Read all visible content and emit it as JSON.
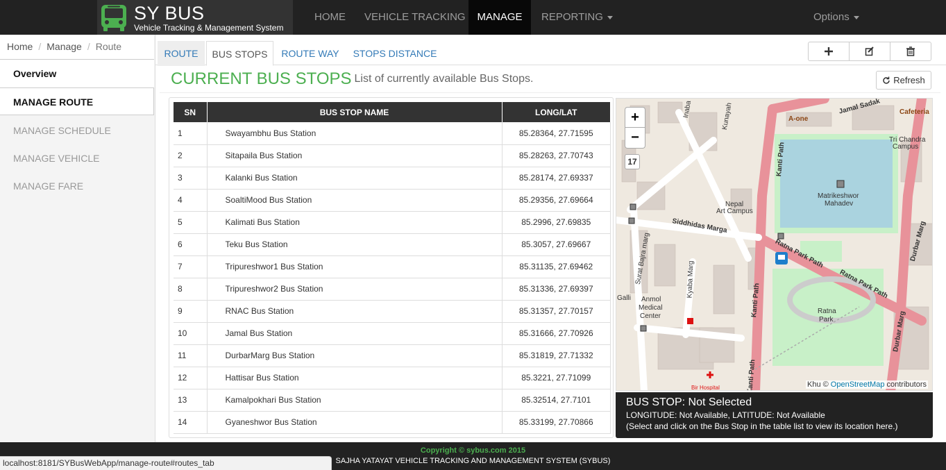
{
  "brand": {
    "title": "SY BUS",
    "subtitle": "Vehicle Tracking & Management System"
  },
  "nav": {
    "home": "HOME",
    "tracking": "VEHICLE TRACKING",
    "manage": "MANAGE",
    "reporting": "REPORTING",
    "options": "Options"
  },
  "breadcrumb": {
    "home": "Home",
    "manage": "Manage",
    "route": "Route",
    "sep": "/"
  },
  "sidebar": {
    "overview": "Overview",
    "manage_route": "MANAGE ROUTE",
    "manage_schedule": "MANAGE SCHEDULE",
    "manage_vehicle": "MANAGE VEHICLE",
    "manage_fare": "MANAGE FARE"
  },
  "tabs": {
    "route": "ROUTE",
    "bus_stops": "BUS STOPS",
    "route_way": "ROUTE WAY",
    "stops_distance": "STOPS DISTANCE"
  },
  "actions": {
    "add_icon": "plus-icon",
    "edit_icon": "edit-icon",
    "delete_icon": "trash-icon"
  },
  "heading": {
    "title": "CURRENT BUS STOPS",
    "subtitle": "List of currently available Bus Stops."
  },
  "refresh": {
    "label": "Refresh",
    "icon": "refresh-icon"
  },
  "table": {
    "headers": {
      "sn": "SN",
      "name": "BUS STOP NAME",
      "longlat": "LONG/LAT"
    },
    "rows": [
      {
        "sn": "1",
        "name": "Swayambhu Bus Station",
        "longlat": "85.28364, 27.71595"
      },
      {
        "sn": "2",
        "name": "Sitapaila Bus Station",
        "longlat": "85.28263, 27.70743"
      },
      {
        "sn": "3",
        "name": "Kalanki Bus Station",
        "longlat": "85.28174, 27.69337"
      },
      {
        "sn": "4",
        "name": "SoaltiMood Bus Station",
        "longlat": "85.29356, 27.69664"
      },
      {
        "sn": "5",
        "name": "Kalimati Bus Station",
        "longlat": "85.2996, 27.69835"
      },
      {
        "sn": "6",
        "name": "Teku Bus Station",
        "longlat": "85.3057, 27.69667"
      },
      {
        "sn": "7",
        "name": "Tripureshwor1 Bus Station",
        "longlat": "85.31135, 27.69462"
      },
      {
        "sn": "8",
        "name": "Tripureshwor2 Bus Station",
        "longlat": "85.31336, 27.69397"
      },
      {
        "sn": "9",
        "name": "RNAC Bus Station",
        "longlat": "85.31357, 27.70157"
      },
      {
        "sn": "10",
        "name": "Jamal Bus Station",
        "longlat": "85.31666, 27.70926"
      },
      {
        "sn": "11",
        "name": "DurbarMarg Bus Station",
        "longlat": "85.31819, 27.71332"
      },
      {
        "sn": "12",
        "name": "Hattisar Bus Station",
        "longlat": "85.3221, 27.71099"
      },
      {
        "sn": "13",
        "name": "Kamalpokhari Bus Station",
        "longlat": "85.32514, 27.7101"
      },
      {
        "sn": "14",
        "name": "Gyaneshwor Bus Station",
        "longlat": "85.33199, 27.70866"
      }
    ]
  },
  "map": {
    "zoom_in": "+",
    "zoom_out": "−",
    "zoom_level": "17",
    "attribution_prefix": "Khu ©",
    "attribution_link": "OpenStreetMap",
    "attribution_suffix": "contributors",
    "labels": {
      "jamal_sadak": "Jamal Sadak",
      "cafeteria": "Cafeteria",
      "a_one": "A-one",
      "tri_chandra": "Tri Chandra",
      "campus": "Campus",
      "kanti_path": "Kanti Path",
      "matrikeshwor": "Matrikeshwor",
      "mahadev": "Mahadev",
      "nepal": "Nepal",
      "art_campus": "Art Campus",
      "siddhidas_marga": "Siddhidas Marga",
      "ratna_park_path": "Ratna Park Path",
      "surat_bajra_marg": "Surat Bajra marg",
      "kyaba_marg": "Kyaba Marg",
      "anmol": "Anmol",
      "medical": "Medical",
      "center": "Center",
      "ratna": "Ratna",
      "park": "Park",
      "durbar_marg": "Durbar Marg",
      "bir_hospital": "Bir Hospital",
      "kunayah": "Kunayah",
      "galli": "Galli",
      "inabahal": "Inaba"
    },
    "colors": {
      "road": "#e8929a",
      "park": "#c8f0c8",
      "water": "#aad3df",
      "building": "#d9d0c9",
      "bg": "#efe9e0"
    }
  },
  "info": {
    "title": "BUS STOP: Not Selected",
    "coords": "LONGITUDE: Not Available, LATITUDE: Not Available",
    "hint": "(Select and click on the Bus Stop in the table list to view its location here.)"
  },
  "footer": {
    "copyright": "Copyright © sybus.com 2015",
    "text": "SAJHA YATAYAT VEHICLE TRACKING AND MANAGEMENT SYSTEM (SYBUS)"
  },
  "status_url": "localhost:8181/SYBusWebApp/manage-route#routes_tab",
  "accent": "#4caf50"
}
